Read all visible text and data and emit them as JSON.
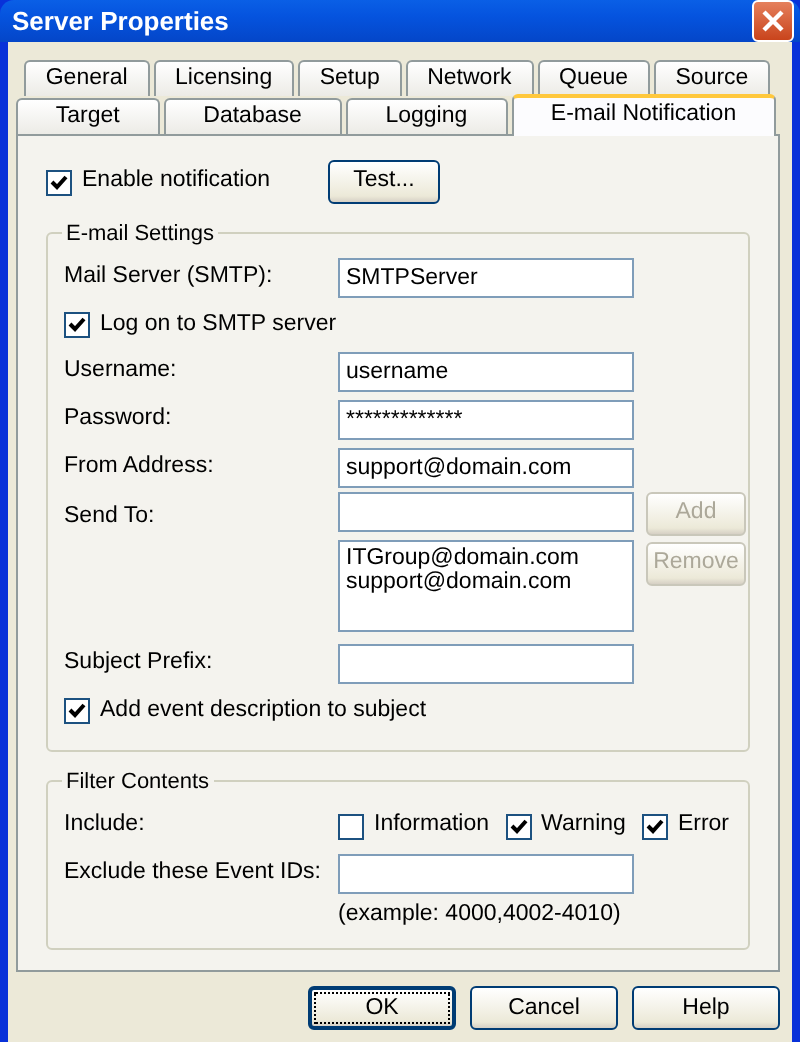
{
  "window": {
    "title": "Server Properties"
  },
  "tab_rows": [
    {
      "tabs": [
        {
          "label": "General",
          "selected": false
        },
        {
          "label": "Licensing",
          "selected": false
        },
        {
          "label": "Setup",
          "selected": false
        },
        {
          "label": "Network",
          "selected": false
        },
        {
          "label": "Queue",
          "selected": false
        },
        {
          "label": "Source",
          "selected": false
        }
      ]
    },
    {
      "tabs": [
        {
          "label": "Target",
          "selected": false
        },
        {
          "label": "Database",
          "selected": false
        },
        {
          "label": "Logging",
          "selected": false
        },
        {
          "label": "E-mail Notification",
          "selected": true
        }
      ]
    }
  ],
  "enable": {
    "label": "Enable notification",
    "checked": true,
    "button": "Test..."
  },
  "email_settings": {
    "title": "E-mail Settings",
    "items": [
      {
        "kind": "field",
        "label": "Mail Server (SMTP):",
        "value": "SMTPServer"
      },
      {
        "kind": "checkbox",
        "label": "Log on to SMTP server",
        "checked": true
      },
      {
        "kind": "field",
        "label": "Username:",
        "value": "username"
      },
      {
        "kind": "field",
        "label": "Password:",
        "value": "*************"
      },
      {
        "kind": "field",
        "label": "From Address:",
        "value": "support@domain.com"
      },
      {
        "kind": "recipients",
        "label": "Send To:",
        "buttons": [
          {
            "label": "Add",
            "disabled": true
          },
          {
            "label": "Remove",
            "disabled": true
          }
        ],
        "list": [
          "ITGroup@domain.com",
          "support@domain.com"
        ]
      },
      {
        "kind": "field",
        "label": "Subject Prefix:"
      },
      {
        "kind": "checkbox",
        "label": "Add event description to subject",
        "checked": true
      }
    ]
  },
  "filter": {
    "title": "Filter Contents",
    "include": {
      "label": "Include:",
      "options": [
        {
          "label": "Information",
          "checked": false
        },
        {
          "label": "Warning",
          "checked": true
        },
        {
          "label": "Error",
          "checked": true
        }
      ]
    },
    "exclude": {
      "label": "Exclude these Event IDs:",
      "hint": "(example: 4000,4002-4010)"
    }
  },
  "buttons": [
    {
      "label": "OK",
      "default": true
    },
    {
      "label": "Cancel",
      "default": false
    },
    {
      "label": "Help",
      "default": false
    }
  ]
}
